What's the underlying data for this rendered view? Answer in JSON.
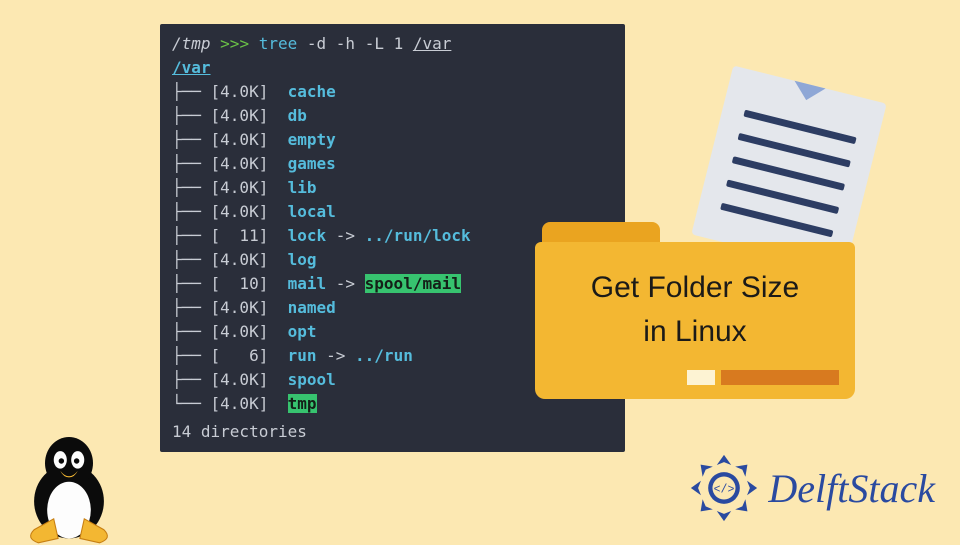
{
  "prompt": {
    "cwd": "/tmp",
    "arrows": ">>>"
  },
  "command": {
    "name": "tree",
    "args": "-d -h -L 1",
    "path": "/var"
  },
  "root": "/var",
  "entries": [
    {
      "branch": "├── ",
      "size": "4.0K",
      "name": "cache"
    },
    {
      "branch": "├── ",
      "size": "4.0K",
      "name": "db"
    },
    {
      "branch": "├── ",
      "size": "4.0K",
      "name": "empty"
    },
    {
      "branch": "├── ",
      "size": "4.0K",
      "name": "games"
    },
    {
      "branch": "├── ",
      "size": "4.0K",
      "name": "lib"
    },
    {
      "branch": "├── ",
      "size": "4.0K",
      "name": "local"
    },
    {
      "branch": "├── ",
      "size": "  11",
      "name": "lock",
      "link": "../run/lock"
    },
    {
      "branch": "├── ",
      "size": "4.0K",
      "name": "log"
    },
    {
      "branch": "├── ",
      "size": "  10",
      "name": "mail",
      "link": "spool/mail",
      "hl": true
    },
    {
      "branch": "├── ",
      "size": "4.0K",
      "name": "named"
    },
    {
      "branch": "├── ",
      "size": "4.0K",
      "name": "opt"
    },
    {
      "branch": "├── ",
      "size": "   6",
      "name": "run",
      "link": "../run"
    },
    {
      "branch": "├── ",
      "size": "4.0K",
      "name": "spool"
    },
    {
      "branch": "└── ",
      "size": "4.0K",
      "name": "tmp",
      "hlName": true
    }
  ],
  "summary": "14 directories",
  "card": {
    "line1": "Get Folder Size",
    "line2": "in Linux"
  },
  "brand": "DelftStack"
}
